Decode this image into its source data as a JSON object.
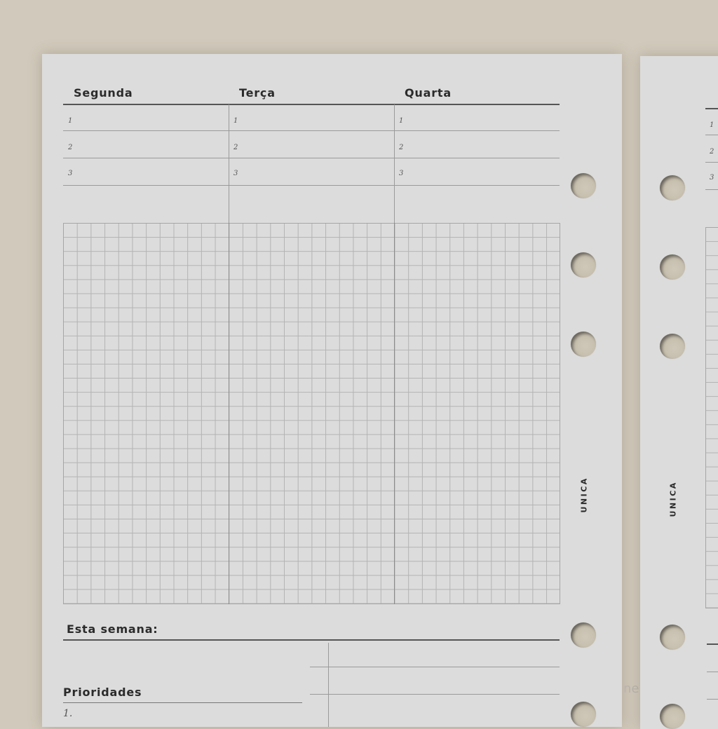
{
  "left_page": {
    "days": [
      "Segunda",
      "Terça",
      "Quarta"
    ],
    "row_numbers": [
      "1",
      "2",
      "3"
    ],
    "brand": "UNICA",
    "week_label": "Esta semana:",
    "priorities_label": "Prioridades",
    "priority_first": "1."
  },
  "right_page": {
    "row_numbers": [
      "1",
      "2",
      "3"
    ],
    "brand": "UNICA"
  },
  "watermark": "ne"
}
